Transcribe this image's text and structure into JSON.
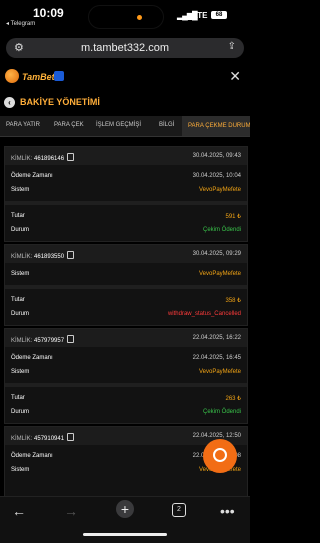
{
  "status_bar": {
    "time": "10:09",
    "back_app": "◂ Telegram",
    "signal": "▂▄▆█",
    "network": "LTE",
    "battery": "68"
  },
  "browser": {
    "url": "m.tambet332.com"
  },
  "site": {
    "logo_text": "TamBet"
  },
  "page": {
    "title": "BAKİYE YÖNETİMİ"
  },
  "tabs": [
    "PARA YATIR",
    "PARA ÇEK",
    "İŞLEM GEÇMİŞİ",
    "BİLGİ",
    "PARA ÇEKME DURUM"
  ],
  "transactions": [
    {
      "id_label": "KİMLİK:",
      "id": "461896146",
      "date": "30.04.2025, 09:43",
      "rows": [
        {
          "label": "Ödeme Zamanı",
          "value": "30.04.2025, 10:04"
        },
        {
          "label": "Sistem",
          "value": "VevoPayMefete"
        },
        {
          "label": "Tutar",
          "value": "591 ₺"
        },
        {
          "label": "Durum",
          "value": "Çekim Ödendi"
        }
      ]
    },
    {
      "id_label": "KİMLİK:",
      "id": "461893550",
      "date": "30.04.2025, 09:29",
      "rows": [
        {
          "label": "Sistem",
          "value": "VevoPayMefete"
        },
        {
          "label": "Tutar",
          "value": "358 ₺"
        },
        {
          "label": "Durum",
          "value": "withdraw_status_Cancelled"
        }
      ]
    },
    {
      "id_label": "KİMLİK:",
      "id": "457979957",
      "date": "22.04.2025, 16:22",
      "rows": [
        {
          "label": "Ödeme Zamanı",
          "value": "22.04.2025, 16:45"
        },
        {
          "label": "Sistem",
          "value": "VevoPayMefete"
        },
        {
          "label": "Tutar",
          "value": "263 ₺"
        },
        {
          "label": "Durum",
          "value": "Çekim Ödendi"
        }
      ]
    },
    {
      "id_label": "KİMLİK:",
      "id": "457910941",
      "date": "22.04.2025, 12:50",
      "rows": [
        {
          "label": "Ödeme Zamanı",
          "value": "22.04.2025, 13:08"
        },
        {
          "label": "Sistem",
          "value": "VevoPayMefete"
        }
      ]
    }
  ],
  "bottom_bar": {
    "tab_count": "2"
  },
  "colors": {
    "accent": "#ffae3a",
    "amount": "#f2a415",
    "paid": "#39c24a",
    "cancelled": "#ff3b3b",
    "chat": "#f26d15"
  }
}
